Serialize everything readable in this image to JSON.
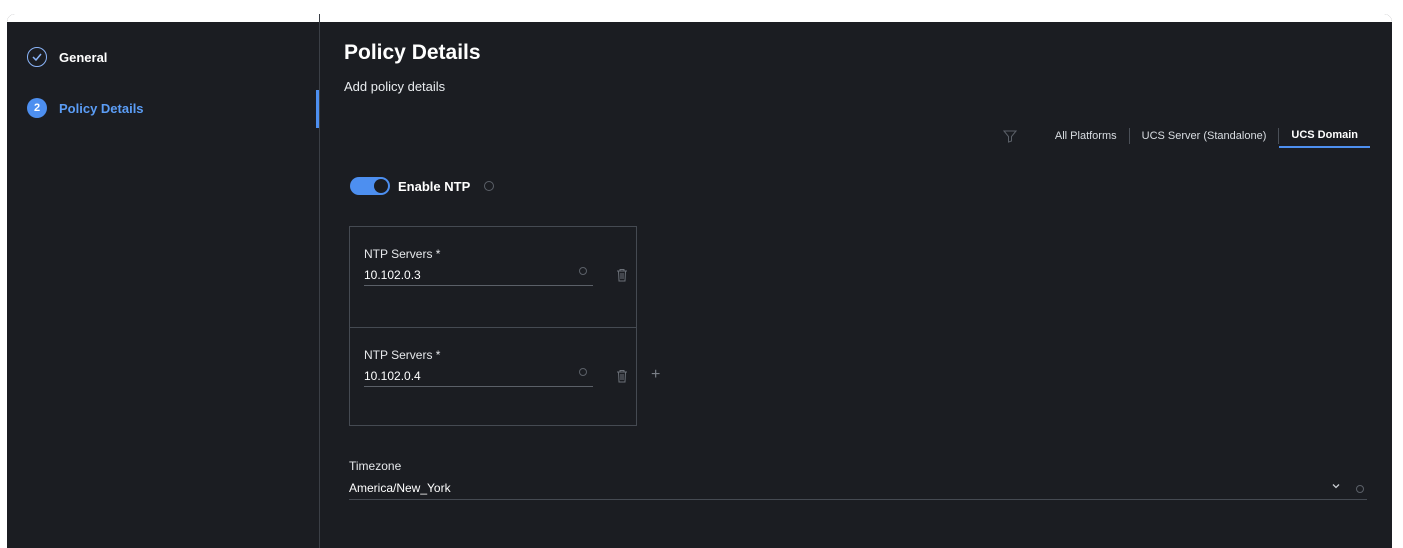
{
  "steps": [
    {
      "number": "",
      "label": "General",
      "status": "done"
    },
    {
      "number": "2",
      "label": "Policy Details",
      "status": "active"
    }
  ],
  "main": {
    "title": "Policy Details",
    "subtitle": "Add policy details"
  },
  "platforms": {
    "tabs": [
      "All Platforms",
      "UCS Server (Standalone)",
      "UCS Domain"
    ],
    "selected": "UCS Domain"
  },
  "enable_ntp": {
    "label": "Enable NTP",
    "enabled": true
  },
  "ntp_servers": [
    {
      "label": "NTP Servers *",
      "value": "10.102.0.3"
    },
    {
      "label": "NTP Servers *",
      "value": "10.102.0.4"
    }
  ],
  "timezone": {
    "label": "Timezone",
    "value": "America/New_York"
  },
  "colors": {
    "accent": "#4d8ff0",
    "background": "#1b1d22"
  },
  "icons": [
    "check-circle-icon",
    "filter-icon",
    "info-icon",
    "trash-icon",
    "plus-icon",
    "chevron-down-icon"
  ]
}
